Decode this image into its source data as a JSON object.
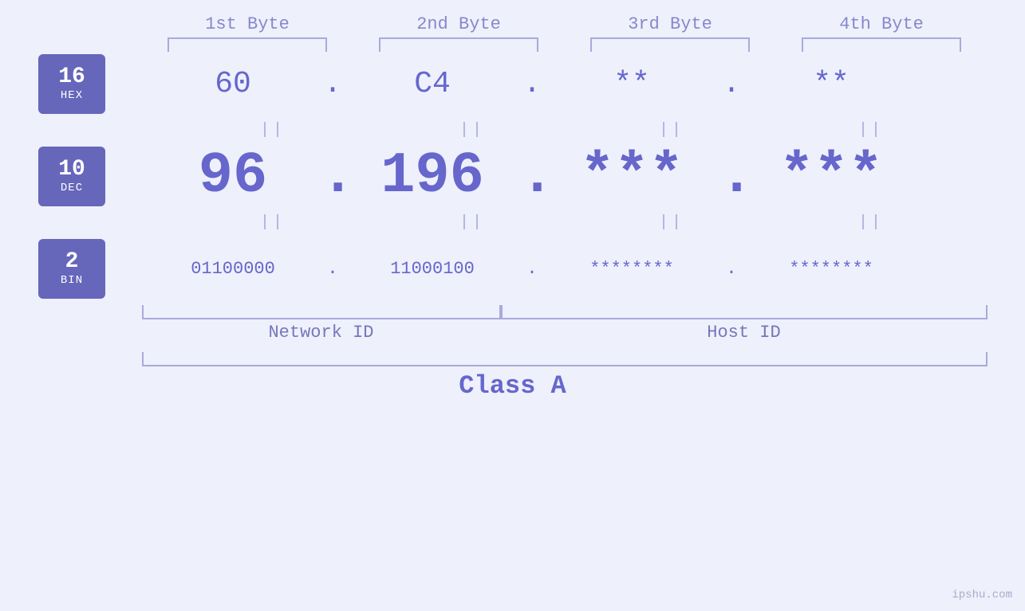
{
  "headers": {
    "byte1": "1st Byte",
    "byte2": "2nd Byte",
    "byte3": "3rd Byte",
    "byte4": "4th Byte"
  },
  "badges": {
    "hex": {
      "num": "16",
      "label": "HEX"
    },
    "dec": {
      "num": "10",
      "label": "DEC"
    },
    "bin": {
      "num": "2",
      "label": "BIN"
    }
  },
  "hex_values": {
    "b1": "60",
    "b2": "C4",
    "b3": "**",
    "b4": "**",
    "dot": "."
  },
  "dec_values": {
    "b1": "96",
    "b2": "196",
    "b3": "***",
    "b4": "***",
    "dot": "."
  },
  "bin_values": {
    "b1": "01100000",
    "b2": "11000100",
    "b3": "********",
    "b4": "********",
    "dot": "."
  },
  "labels": {
    "network_id": "Network ID",
    "host_id": "Host ID",
    "class": "Class A"
  },
  "watermark": "ipshu.com"
}
